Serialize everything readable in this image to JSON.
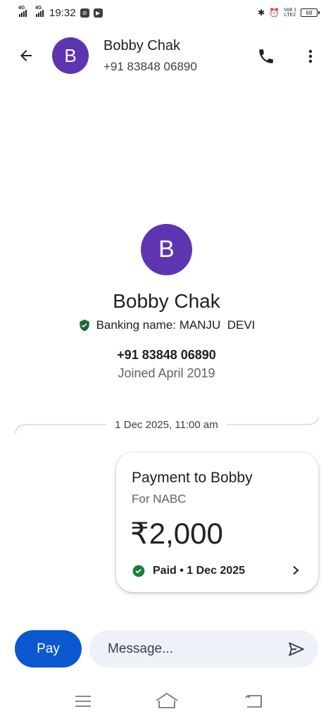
{
  "status_bar": {
    "network_1": "4G",
    "network_2": "4G",
    "time": "19:32",
    "lte_top": "Vo8 1",
    "lte_bottom": "LTE2",
    "battery": "68"
  },
  "header": {
    "avatar_letter": "B",
    "contact_name": "Bobby Chak",
    "contact_phone": "+91 83848 06890",
    "avatar_color": "#5e35b1"
  },
  "profile": {
    "avatar_letter": "B",
    "name": "Bobby Chak",
    "banking_name": "Banking name: MANJU  DEVI",
    "phone": "+91 83848 06890",
    "joined": "Joined April 2019"
  },
  "conversation": {
    "date_label": "1 Dec 2025, 11:00 am",
    "payment": {
      "title": "Payment to Bobby",
      "note": "For NABC",
      "amount": "₹2,000",
      "status": "Paid • 1 Dec 2025",
      "status_color": "#188038"
    }
  },
  "composer": {
    "pay_label": "Pay",
    "message_placeholder": "Message...",
    "accent_color": "#0b57d0"
  },
  "icons": {
    "back": "arrow-left-icon",
    "call": "phone-icon",
    "more": "more-vertical-icon",
    "verified": "shield-check-icon",
    "paid": "check-circle-icon",
    "chevron": "chevron-right-icon",
    "send": "send-icon"
  }
}
